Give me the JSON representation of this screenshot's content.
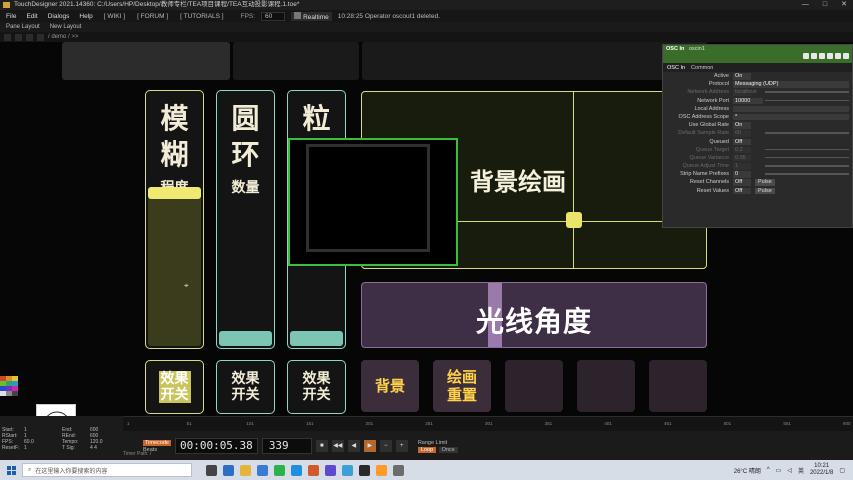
{
  "window": {
    "title": "TouchDesigner 2021.14360: C:/Users/HP/Desktop/教师专栏/TEA项目课程/TEA互动投影课程.1.toe*",
    "controls": [
      "—",
      "□",
      "✕"
    ]
  },
  "menubar": {
    "items": [
      "File",
      "Edit",
      "Dialogs",
      "Help"
    ],
    "tags": [
      "[ WIKI ]",
      "[ FORUM ]",
      "[ TUTORIALS ]"
    ],
    "fps_label": "FPS:",
    "fps_value": "60",
    "realtime_label": "Realtime",
    "status": "10:28:25 Operator oscout1 deleted."
  },
  "toolbar": {
    "pane_layout": "Pane Layout",
    "new_layout": "New Layout",
    "path": "/ demo / >>"
  },
  "ui": {
    "slider_blur": {
      "big": [
        "模",
        "糊"
      ],
      "small": "程度",
      "value": 0.6
    },
    "slider_ring": {
      "big": [
        "圆",
        "环"
      ],
      "small": "数量",
      "value": 0.06
    },
    "slider_grain": {
      "big": [
        "粒"
      ],
      "small": "",
      "value": 0.06
    },
    "xy_pad_label": "背景绘画",
    "angle_label": "光线角度",
    "angle_value": 0.38,
    "toggle_1": [
      "效果",
      "开关"
    ],
    "toggle_2": [
      "效果",
      "开关"
    ],
    "toggle_3": [
      "效果",
      "开关"
    ],
    "btn_background": "背景",
    "btn_reset": [
      "绘画",
      "重置"
    ]
  },
  "params": {
    "op_type": "OSC In",
    "op_name": "oscin1",
    "tabs": [
      "OSC In",
      "Common"
    ],
    "rows": [
      {
        "label": "Active",
        "value": "On",
        "dim": false
      },
      {
        "label": "Protocol",
        "value": "Messaging (UDP)",
        "dim": false
      },
      {
        "label": "Network Address",
        "value": "localhost",
        "dim": true
      },
      {
        "label": "Network Port",
        "value": "10000",
        "dim": false
      },
      {
        "label": "Local Address",
        "value": "",
        "dim": false
      },
      {
        "label": "OSC Address Scope",
        "value": "*",
        "dim": false
      },
      {
        "label": "Use Global Rate",
        "value": "On",
        "dim": false
      },
      {
        "label": "Default Sample Rate",
        "value": "60",
        "dim": true
      },
      {
        "label": "Queued",
        "value": "Off",
        "dim": false
      },
      {
        "label": "Queue Target",
        "value": "0.2",
        "dim": true
      },
      {
        "label": "Queue Variance",
        "value": "0.05",
        "dim": true
      },
      {
        "label": "Queue Adjust Time",
        "value": "1",
        "dim": true
      },
      {
        "label": "Strip Name Prefixes",
        "value": "0",
        "dim": false
      },
      {
        "label": "Reset Channels",
        "value": "Off",
        "dim": false,
        "pulse": "Pulse"
      },
      {
        "label": "Reset Values",
        "value": "Off",
        "dim": false,
        "pulse": "Pulse"
      }
    ]
  },
  "timeline": {
    "info": {
      "start_label": "Start:",
      "start": "1",
      "end_label": "End:",
      "end": "600",
      "rstart_label": "RStart:",
      "rstart": "1",
      "rend_label": "REnd:",
      "rend": "600",
      "fps_label": "FPS:",
      "fps": "60.0",
      "tempo_label": "Tempo:",
      "tempo": "120.0",
      "resetf_label": "ResetF:",
      "resetf": "1",
      "tsig_label": "T Sig:",
      "tsig": "4   4"
    },
    "ruler_ticks": [
      "1",
      "51",
      "101",
      "151",
      "201",
      "251",
      "301",
      "351",
      "401",
      "451",
      "501",
      "551",
      "600"
    ],
    "units": [
      "Timecode",
      "Beats"
    ],
    "timecode": "00:00:05.38",
    "frame": "339",
    "range_label": "Range Limit",
    "range_buttons": [
      "Loop",
      "Once"
    ],
    "timer_path": "Timer Path: /"
  },
  "taskbar": {
    "search_placeholder": "在这里输入你要搜索的内容",
    "weather": "26°C 晴朗",
    "time": "10:21",
    "date": "2022/1/8",
    "lang": "英"
  },
  "palette_colors": [
    "#c94a2a",
    "#e08a2a",
    "#d9c92a",
    "#6cc02a",
    "#2aa86a",
    "#2a9ac8",
    "#2a4ac8",
    "#7a2ac8",
    "#c82aa8",
    "#e0e0e0",
    "#888888",
    "#444444"
  ]
}
